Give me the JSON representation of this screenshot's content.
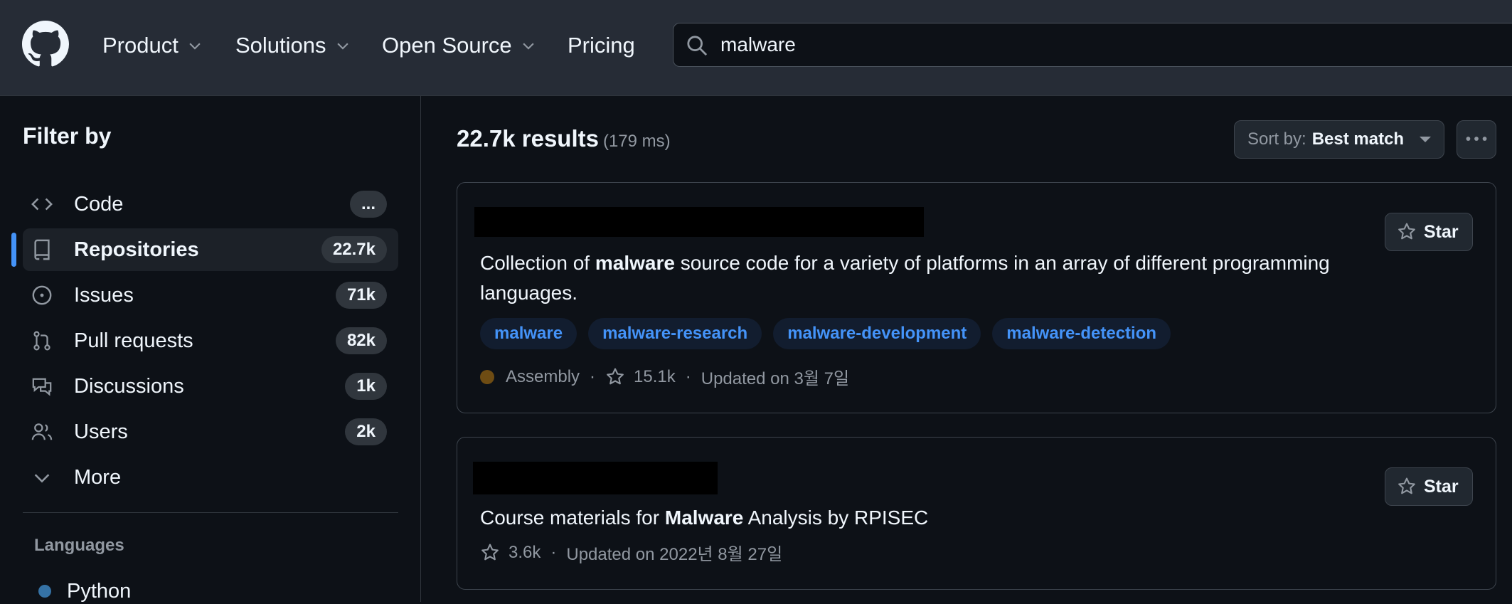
{
  "header": {
    "nav": [
      "Product",
      "Solutions",
      "Open Source",
      "Pricing"
    ],
    "search_value": "malware"
  },
  "sidebar": {
    "title": "Filter by",
    "items": [
      {
        "label": "Code",
        "count": "...",
        "icon": "code-icon"
      },
      {
        "label": "Repositories",
        "count": "22.7k",
        "icon": "repo-icon",
        "active": true
      },
      {
        "label": "Issues",
        "count": "71k",
        "icon": "issue-icon"
      },
      {
        "label": "Pull requests",
        "count": "82k",
        "icon": "pull-request-icon"
      },
      {
        "label": "Discussions",
        "count": "1k",
        "icon": "discussion-icon"
      },
      {
        "label": "Users",
        "count": "2k",
        "icon": "users-icon"
      },
      {
        "label": "More",
        "icon": "chevron-down-icon"
      }
    ],
    "languages_title": "Languages",
    "languages": [
      {
        "label": "Python",
        "color": "#3572A5"
      }
    ]
  },
  "results": {
    "count": "22.7k results",
    "time": "(179 ms)",
    "sort_key": "Sort by:",
    "sort_value": "Best match"
  },
  "repos": [
    {
      "desc_pre": "Collection of ",
      "desc_bold": "malware",
      "desc_post": " source code for a variety of platforms in an array of different programming languages.",
      "topics": [
        "malware",
        "malware-research",
        "malware-development",
        "malware-detection"
      ],
      "language": "Assembly",
      "language_color": "#6e4c13",
      "stars": "15.1k",
      "updated": "Updated on 3월 7일",
      "star_label": "Star"
    },
    {
      "desc_pre": "Course materials for ",
      "desc_bold": "Malware",
      "desc_post": " Analysis by RPISEC",
      "stars": "3.6k",
      "updated": "Updated on 2022년 8월 27일",
      "star_label": "Star"
    }
  ],
  "colors": {
    "accent": "#4493f8",
    "background": "#0d1117",
    "header": "#262c36"
  }
}
